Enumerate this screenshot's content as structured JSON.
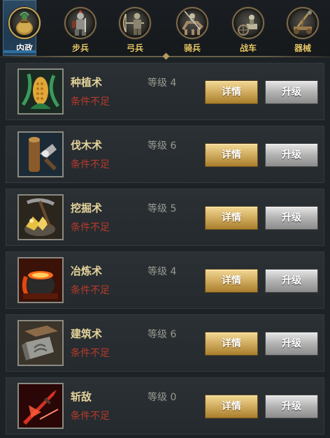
{
  "tabs": [
    {
      "label": "内政",
      "icon": "money-bag-icon",
      "active": true
    },
    {
      "label": "步兵",
      "icon": "knight-icon",
      "active": false
    },
    {
      "label": "弓兵",
      "icon": "archer-icon",
      "active": false
    },
    {
      "label": "骑兵",
      "icon": "cavalry-icon",
      "active": false
    },
    {
      "label": "战车",
      "icon": "chariot-icon",
      "active": false
    },
    {
      "label": "器械",
      "icon": "siege-engine-icon",
      "active": false
    }
  ],
  "skills": [
    {
      "name": "种植术",
      "icon": "corn-icon",
      "level": "等级 4",
      "condition": "条件不足",
      "details_label": "详情",
      "upgrade_label": "升级"
    },
    {
      "name": "伐木术",
      "icon": "log-axe-icon",
      "level": "等级 6",
      "condition": "条件不足",
      "details_label": "详情",
      "upgrade_label": "升级"
    },
    {
      "name": "挖掘术",
      "icon": "pickaxe-gold-icon",
      "level": "等级 5",
      "condition": "条件不足",
      "details_label": "详情",
      "upgrade_label": "升级"
    },
    {
      "name": "冶炼术",
      "icon": "furnace-pot-icon",
      "level": "等级 4",
      "condition": "条件不足",
      "details_label": "详情",
      "upgrade_label": "升级"
    },
    {
      "name": "建筑术",
      "icon": "stone-brick-icon",
      "level": "等级 6",
      "condition": "条件不足",
      "details_label": "详情",
      "upgrade_label": "升级"
    },
    {
      "name": "斩敌",
      "icon": "red-blade-icon",
      "level": "等级 0",
      "condition": "条件不足",
      "details_label": "详情",
      "upgrade_label": "升级"
    }
  ],
  "colors": {
    "gold_button": "#d4b064",
    "gray_button": "#b2b2b2",
    "condition_red": "#b83a2a",
    "active_tab": "#1f3a52"
  }
}
